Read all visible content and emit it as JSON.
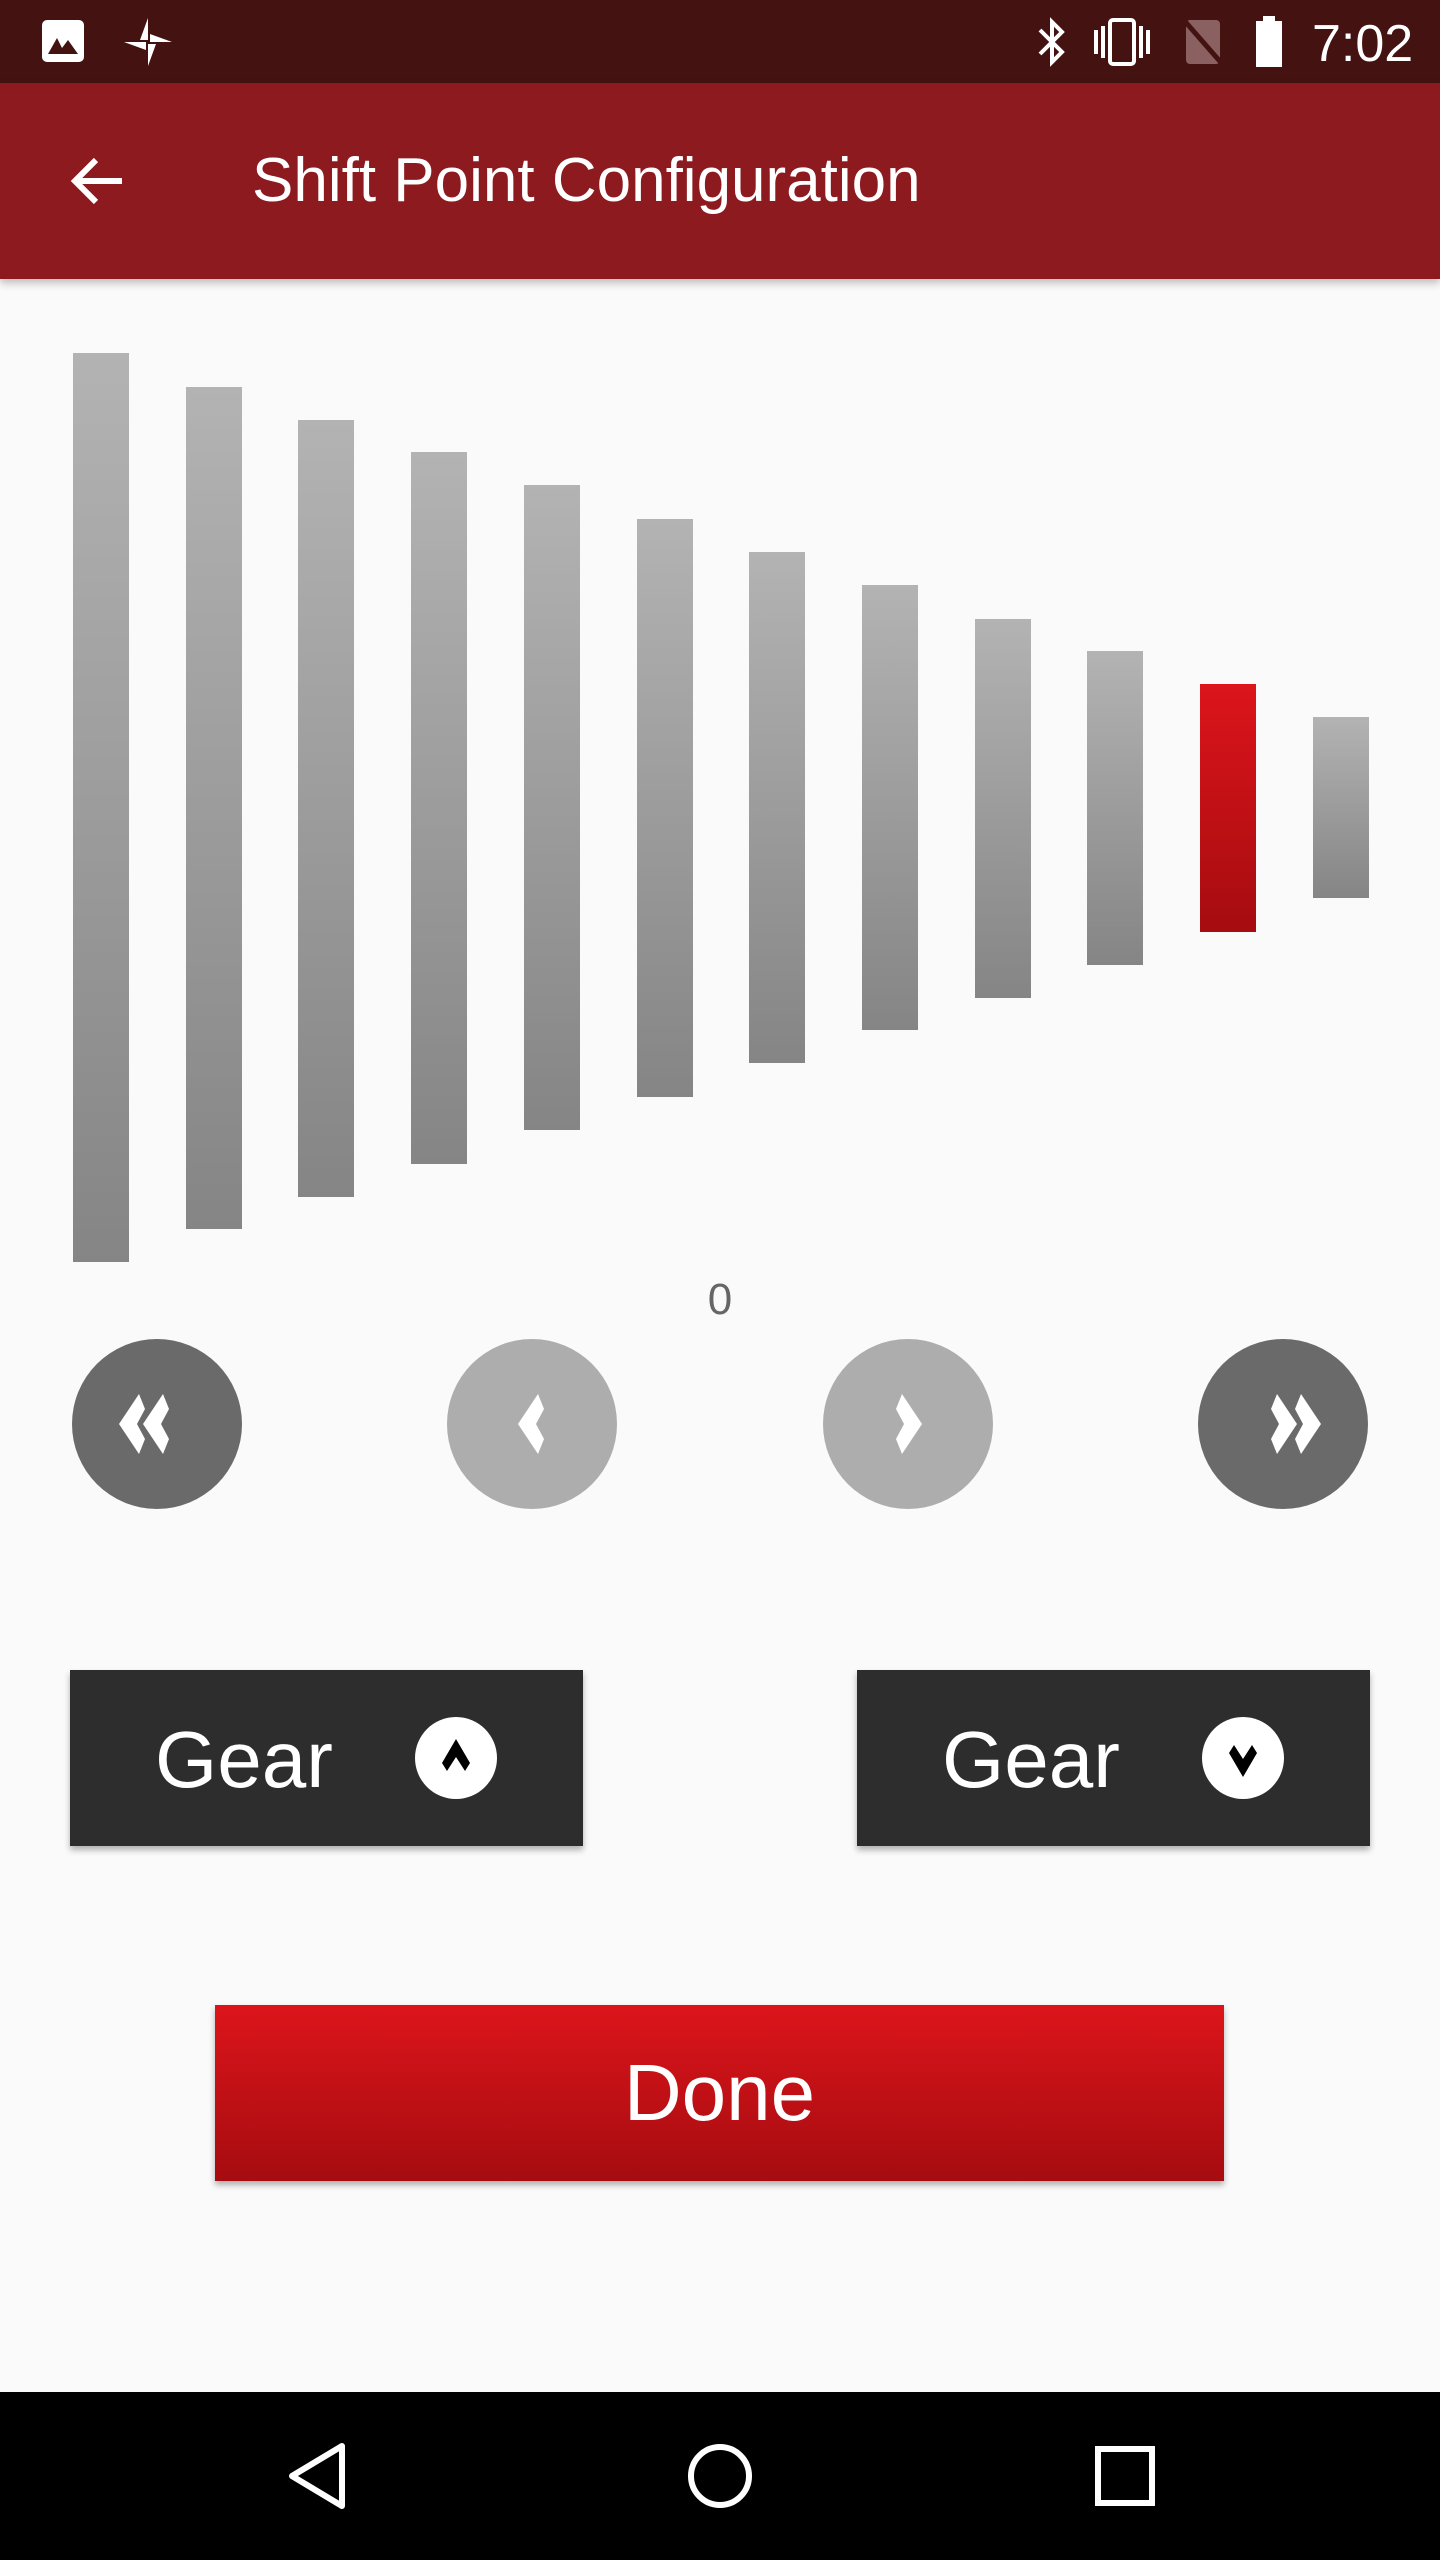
{
  "status_bar": {
    "time": "7:02",
    "icons": [
      "image-icon",
      "pinwheel-icon",
      "bluetooth-icon",
      "vibrate-icon",
      "no-sim-icon",
      "battery-icon"
    ]
  },
  "app_bar": {
    "title": "Shift Point Configuration",
    "back_icon": "arrow-back-icon"
  },
  "shift_points": {
    "count": 12,
    "selected_index": 10,
    "value_label": "0",
    "selected_color": "#dc151b",
    "bar_color": "#a0a0a0"
  },
  "controls": {
    "first_icon": "double-chevron-left-icon",
    "prev_icon": "chevron-left-icon",
    "next_icon": "chevron-right-icon",
    "last_icon": "double-chevron-right-icon"
  },
  "gear_up": {
    "label": "Gear",
    "icon": "chevron-up-circle-icon"
  },
  "gear_down": {
    "label": "Gear",
    "icon": "chevron-down-circle-icon"
  },
  "done": {
    "label": "Done",
    "color": "#c8101a"
  },
  "nav_bar": {
    "icons": [
      "back-triangle-icon",
      "home-circle-icon",
      "recents-square-icon"
    ]
  }
}
